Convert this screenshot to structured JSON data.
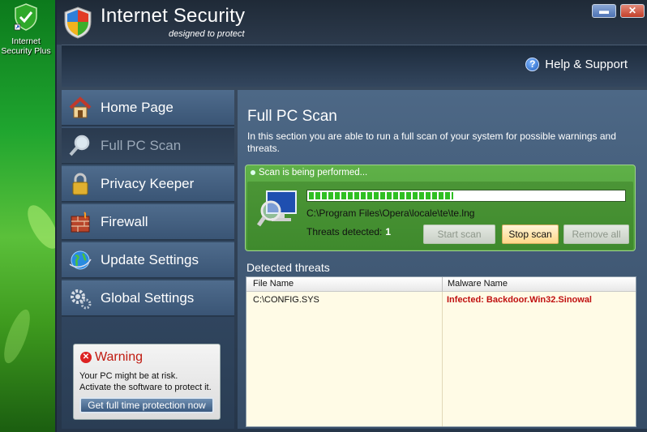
{
  "desktop": {
    "icon_label_line1": "Internet",
    "icon_label_line2": "Security Plus"
  },
  "window": {
    "title": "Internet Security",
    "tagline": "designed to protect",
    "minimize_icon": "minimize-icon",
    "close_icon": "close-icon"
  },
  "header": {
    "help_label": "Help & Support"
  },
  "sidebar": {
    "items": [
      {
        "label": "Home Page",
        "icon": "house-icon"
      },
      {
        "label": "Full PC Scan",
        "icon": "magnifier-icon"
      },
      {
        "label": "Privacy Keeper",
        "icon": "padlock-icon"
      },
      {
        "label": "Firewall",
        "icon": "brick-wall-icon"
      },
      {
        "label": "Update Settings",
        "icon": "globe-icon"
      },
      {
        "label": "Global Settings",
        "icon": "gears-icon"
      }
    ],
    "active_index": 1
  },
  "warning": {
    "title": "Warning",
    "line1": "Your PC might be at risk.",
    "line2": "Activate the software to protect it.",
    "button_label": "Get full time protection now"
  },
  "main": {
    "title": "Full PC Scan",
    "description": "In this section you are able to run a full scan of your system for possible warnings and threats.",
    "scan": {
      "status": "Scan is being performed...",
      "progress_fraction": 0.46,
      "current_file": "C:\\Program Files\\Opera\\locale\\te\\te.lng",
      "threats_label": "Threats detected:",
      "threats_count": "1",
      "start_label": "Start scan",
      "stop_label": "Stop scan",
      "remove_label": "Remove all"
    },
    "detected_title": "Detected threats",
    "table": {
      "columns": [
        "File Name",
        "Malware Name"
      ],
      "rows": [
        [
          "C:\\CONFIG.SYS",
          "Infected: Backdoor.Win32.Sinowal"
        ]
      ]
    }
  },
  "colors": {
    "accent_green": "#5fb148",
    "warning_red": "#c01a10",
    "panel_blue": "#4d6886"
  }
}
